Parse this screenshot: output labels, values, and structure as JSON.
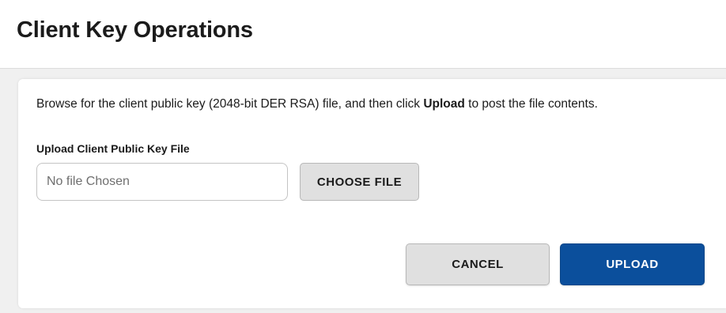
{
  "page": {
    "title": "Client Key Operations"
  },
  "card": {
    "instructions": {
      "before": "Browse for the client public key (2048-bit DER RSA) file, and then click ",
      "bold": "Upload",
      "after": " to post the file contents."
    },
    "upload_field": {
      "label": "Upload Client Public Key File",
      "placeholder": "No file Chosen",
      "value": ""
    },
    "choose_file_label": "CHOOSE FILE",
    "cancel_label": "CANCEL",
    "upload_label": "UPLOAD"
  },
  "colors": {
    "primary": "#0b4f9c",
    "secondary_button": "#e0e0e0",
    "content_background": "#f0f0f0",
    "text": "#1b1b1b"
  }
}
